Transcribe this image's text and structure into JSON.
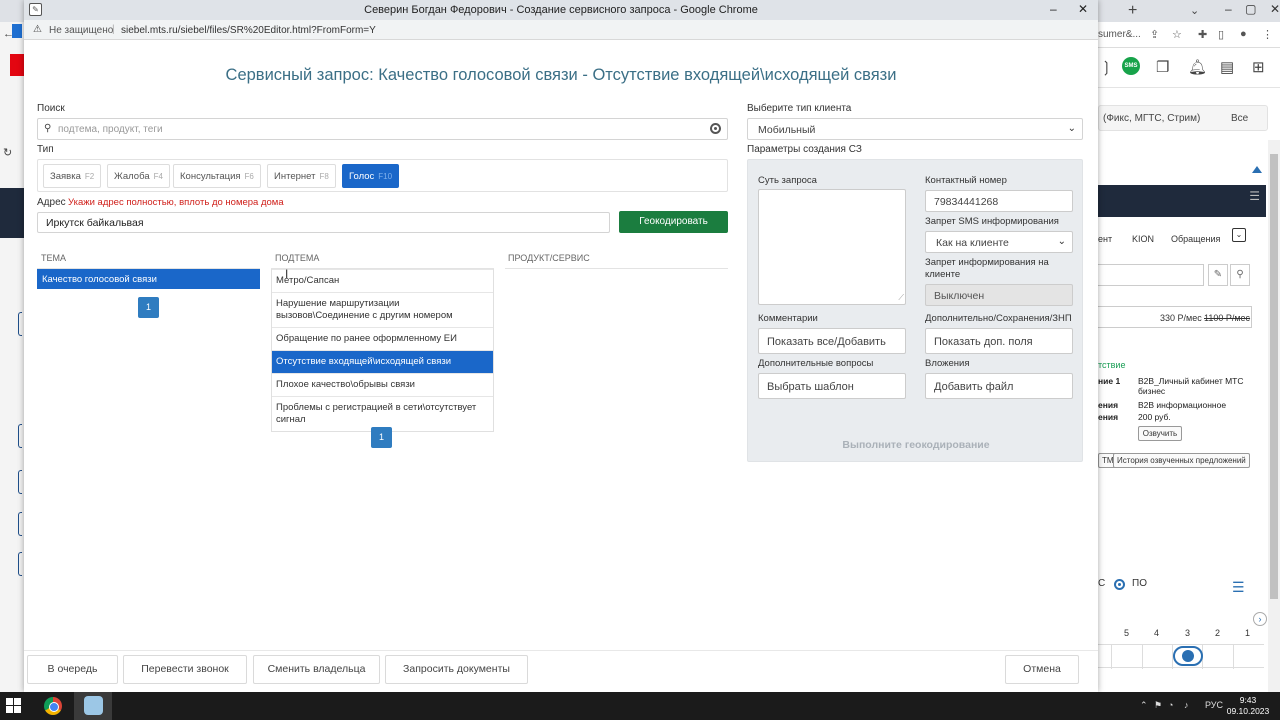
{
  "popup": {
    "window_title": "Северин Богдан Федорович - Создание сервисного запроса - Google Chrome",
    "security_label": "Не защищено",
    "url": "siebel.mts.ru/siebel/files/SR%20Editor.html?FromForm=Y"
  },
  "form": {
    "heading": "Сервисный запрос: Качество голосовой связи - Отсутствие входящей\\исходящей связи",
    "search_label": "Поиск",
    "search_placeholder": "подтема, продукт, теги",
    "type_label": "Тип",
    "types": [
      {
        "label": "Заявка",
        "key": "F2",
        "active": false
      },
      {
        "label": "Жалоба",
        "key": "F4",
        "active": false
      },
      {
        "label": "Консультация",
        "key": "F6",
        "active": false
      },
      {
        "label": "Интернет",
        "key": "F8",
        "active": false
      },
      {
        "label": "Голос",
        "key": "F10",
        "active": true
      }
    ],
    "address_label": "Адрес",
    "address_warning": "Укажи адрес полностью, вплоть до номера дома",
    "address_value": "Иркутск байкальвая",
    "geocode_button": "Геокодировать",
    "columns": {
      "topic": "ТЕМА",
      "subtopic": "ПОДТЕМА",
      "product": "ПРОДУКТ/СЕРВИС"
    },
    "topics": [
      "Качество голосовой связи"
    ],
    "topic_page": "1",
    "subtopics": [
      {
        "label": "Метро/Сапсан",
        "active": false
      },
      {
        "label": "Нарушение маршрутизации вызовов\\Соединение с другим номером",
        "active": false
      },
      {
        "label": "Обращение по ранее оформленному ЕИ",
        "active": false
      },
      {
        "label": "Отсутствие входящей\\исходящей связи",
        "active": true
      },
      {
        "label": "Плохое качество\\обрывы связи",
        "active": false
      },
      {
        "label": "Проблемы с регистрацией в сети\\отсутствует сигнал",
        "active": false
      }
    ],
    "subtopic_page": "1"
  },
  "params": {
    "client_type_label": "Выберите тип клиента",
    "client_type_value": "Мобильный",
    "panel_label": "Параметры создания СЗ",
    "request_essence_label": "Суть запроса",
    "contact_label": "Контактный номер",
    "contact_value": "79834441268",
    "sms_label": "Запрет SMS информирования",
    "sms_value": "Как на клиенте",
    "info_ban_label": "Запрет информирования на клиенте",
    "info_ban_value": "Выключен",
    "comments_label": "Комментарии",
    "comments_button": "Показать все/Добавить",
    "extra_label": "Дополнительно/Сохранения/ЗНП",
    "extra_button": "Показать доп. поля",
    "questions_label": "Дополнительные вопросы",
    "questions_button": "Выбрать шаблон",
    "attachments_label": "Вложения",
    "attachments_button": "Добавить файл",
    "geocode_hint": "Выполните геокодирование"
  },
  "footer": {
    "queue": "В очередь",
    "transfer": "Перевести звонок",
    "owner": "Сменить владельца",
    "docs": "Запросить документы",
    "cancel": "Отмена"
  },
  "background": {
    "url_fragment": "sumer&...",
    "filter_text": "(Фикс, МГТС, Стрим)",
    "filter_all": "Все",
    "tab_kion": "KION",
    "tab_requests": "Обращения",
    "tab_partial": "ент",
    "price_current": "330 Р/мес",
    "price_old": "1100 Р/мес",
    "green_label": "тствие",
    "kv": [
      {
        "k": "ние 1",
        "v": "В2В_Личный кабинет МТС бизнес"
      },
      {
        "k": "ения",
        "v": "В2В информационное"
      },
      {
        "k": "ения",
        "v": "200 руб."
      }
    ],
    "speak_button": "Озвучить",
    "tm_button": "ТМ",
    "history_button": "История озвученных предложений",
    "radio_left": "С",
    "radio_label": "ПО",
    "page_numbers": [
      "5",
      "4",
      "3",
      "2",
      "1"
    ]
  },
  "taskbar": {
    "lang": "РУС",
    "time": "9:43",
    "date": "09.10.2023"
  }
}
